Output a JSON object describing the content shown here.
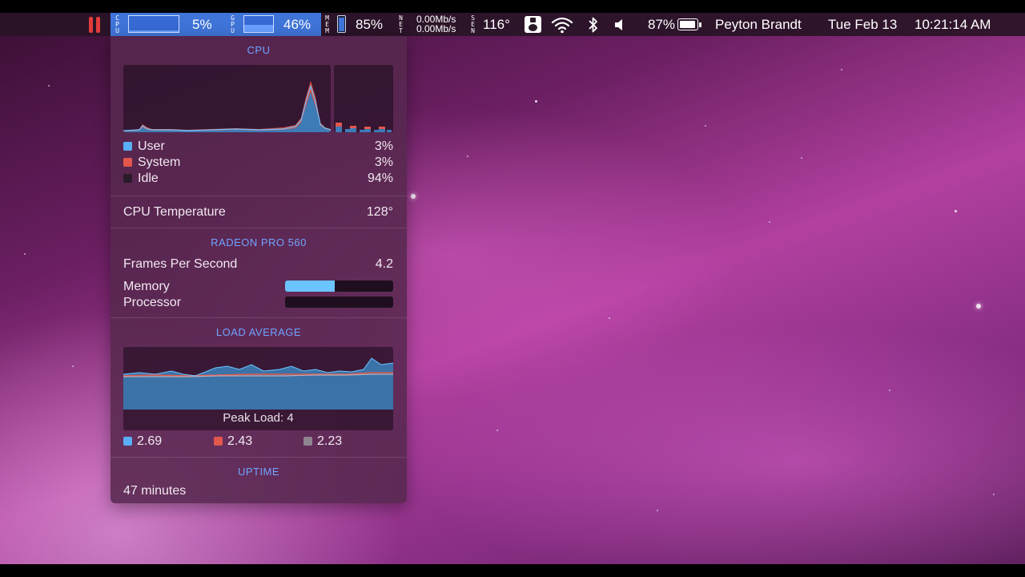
{
  "menubar": {
    "cpu_label": "CPU",
    "cpu_percent": "5%",
    "gpu_label": "GPU",
    "gpu_percent": "46%",
    "mem_label": "MEM",
    "mem_percent": "85%",
    "net_label": "NET",
    "net_up": "0.00Mb/s",
    "net_down": "0.00Mb/s",
    "sensor_label": "SEN",
    "sensor_temp": "116°",
    "battery_percent": "87%",
    "user_name": "Peyton Brandt",
    "date": "Tue Feb 13",
    "time": "10:21:14 AM"
  },
  "panel": {
    "cpu": {
      "title": "CPU",
      "rows": [
        {
          "label": "User",
          "value": "3%",
          "color": "#5aaef5"
        },
        {
          "label": "System",
          "value": "3%",
          "color": "#e2574c"
        },
        {
          "label": "Idle",
          "value": "94%",
          "color": "#2b1a2a"
        }
      ],
      "temperature_label": "CPU Temperature",
      "temperature_value": "128°"
    },
    "gpu": {
      "title": "RADEON PRO 560",
      "fps_label": "Frames Per Second",
      "fps_value": "4.2",
      "memory_label": "Memory",
      "memory_level": 0.46,
      "processor_label": "Processor",
      "processor_level": 0.0
    },
    "load": {
      "title": "LOAD AVERAGE",
      "peak_label": "Peak Load: 4",
      "averages": [
        {
          "value": "2.69",
          "color": "#5aaef5"
        },
        {
          "value": "2.43",
          "color": "#e2574c"
        },
        {
          "value": "2.23",
          "color": "#8f8590"
        }
      ]
    },
    "uptime": {
      "title": "UPTIME",
      "value": "47 minutes"
    }
  },
  "colors": {
    "accent": "#3f74d8",
    "section_title": "#6fa4ff",
    "user": "#5aaef5",
    "system": "#e2574c"
  }
}
